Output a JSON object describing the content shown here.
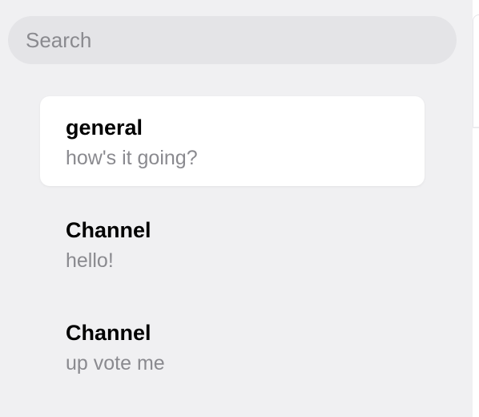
{
  "search": {
    "placeholder": "Search",
    "value": ""
  },
  "channels": [
    {
      "name": "general",
      "preview": "how's it going?",
      "active": true
    },
    {
      "name": "Channel",
      "preview": "hello!",
      "active": false
    },
    {
      "name": "Channel",
      "preview": "up vote me",
      "active": false
    }
  ],
  "colors": {
    "background": "#f0f0f2",
    "search_background": "#e4e4e7",
    "active_item_background": "#ffffff",
    "primary_text": "#000000",
    "secondary_text": "#8a8a8f"
  }
}
